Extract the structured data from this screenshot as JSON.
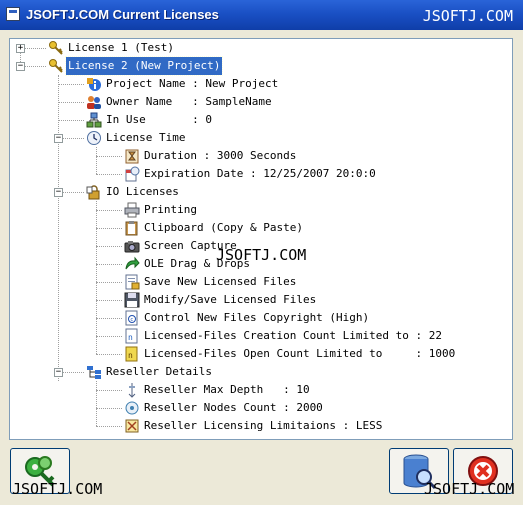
{
  "window": {
    "title": "JSOFTJ.COM Current Licenses",
    "watermark": "JSOFTJ.COM"
  },
  "tree": {
    "items": [
      {
        "label": "License 1 (Test)",
        "icon": "key-icon"
      },
      {
        "label": "License 2 (New Project)",
        "icon": "key-icon",
        "selected": true
      },
      {
        "label": "Project Name : New Project",
        "icon": "info-icon"
      },
      {
        "label": "Owner Name   : SampleName",
        "icon": "users-icon"
      },
      {
        "label": "In Use       : 0",
        "icon": "network-icon"
      },
      {
        "label": "License Time",
        "icon": "clock-icon"
      },
      {
        "label": "Duration : 3000 Seconds",
        "icon": "hourglass-icon"
      },
      {
        "label": "Expiration Date : 12/25/2007 20:0:0",
        "icon": "calendar-clock-icon"
      },
      {
        "label": "IO Licenses",
        "icon": "padlock-icon"
      },
      {
        "label": "Printing",
        "icon": "printer-icon"
      },
      {
        "label": "Clipboard (Copy & Paste)",
        "icon": "clipboard-icon"
      },
      {
        "label": "Screen Capture",
        "icon": "camera-icon"
      },
      {
        "label": "OLE Drag & Drops",
        "icon": "drag-arrow-icon"
      },
      {
        "label": "Save New Licensed Files",
        "icon": "save-file-icon"
      },
      {
        "label": "Modify/Save Licensed Files",
        "icon": "floppy-icon"
      },
      {
        "label": "Control New Files Copyright (High)",
        "icon": "document-copyright-icon"
      },
      {
        "label": "Licensed-Files Creation Count Limited to : 22",
        "icon": "document-count-icon"
      },
      {
        "label": "Licensed-Files Open Count Limited to     : 1000",
        "icon": "document-open-icon"
      },
      {
        "label": "Reseller Details",
        "icon": "org-chart-icon"
      },
      {
        "label": "Reseller Max Depth   : 10",
        "icon": "depth-icon"
      },
      {
        "label": "Reseller Nodes Count : 2000",
        "icon": "nodes-icon"
      },
      {
        "label": "Reseller Licensing Limitaions : LESS",
        "icon": "limit-icon"
      }
    ]
  },
  "buttons": {
    "left": {
      "icon": "keys-icon"
    },
    "middle": {
      "icon": "database-search-icon"
    },
    "right": {
      "icon": "close-red-icon"
    }
  }
}
